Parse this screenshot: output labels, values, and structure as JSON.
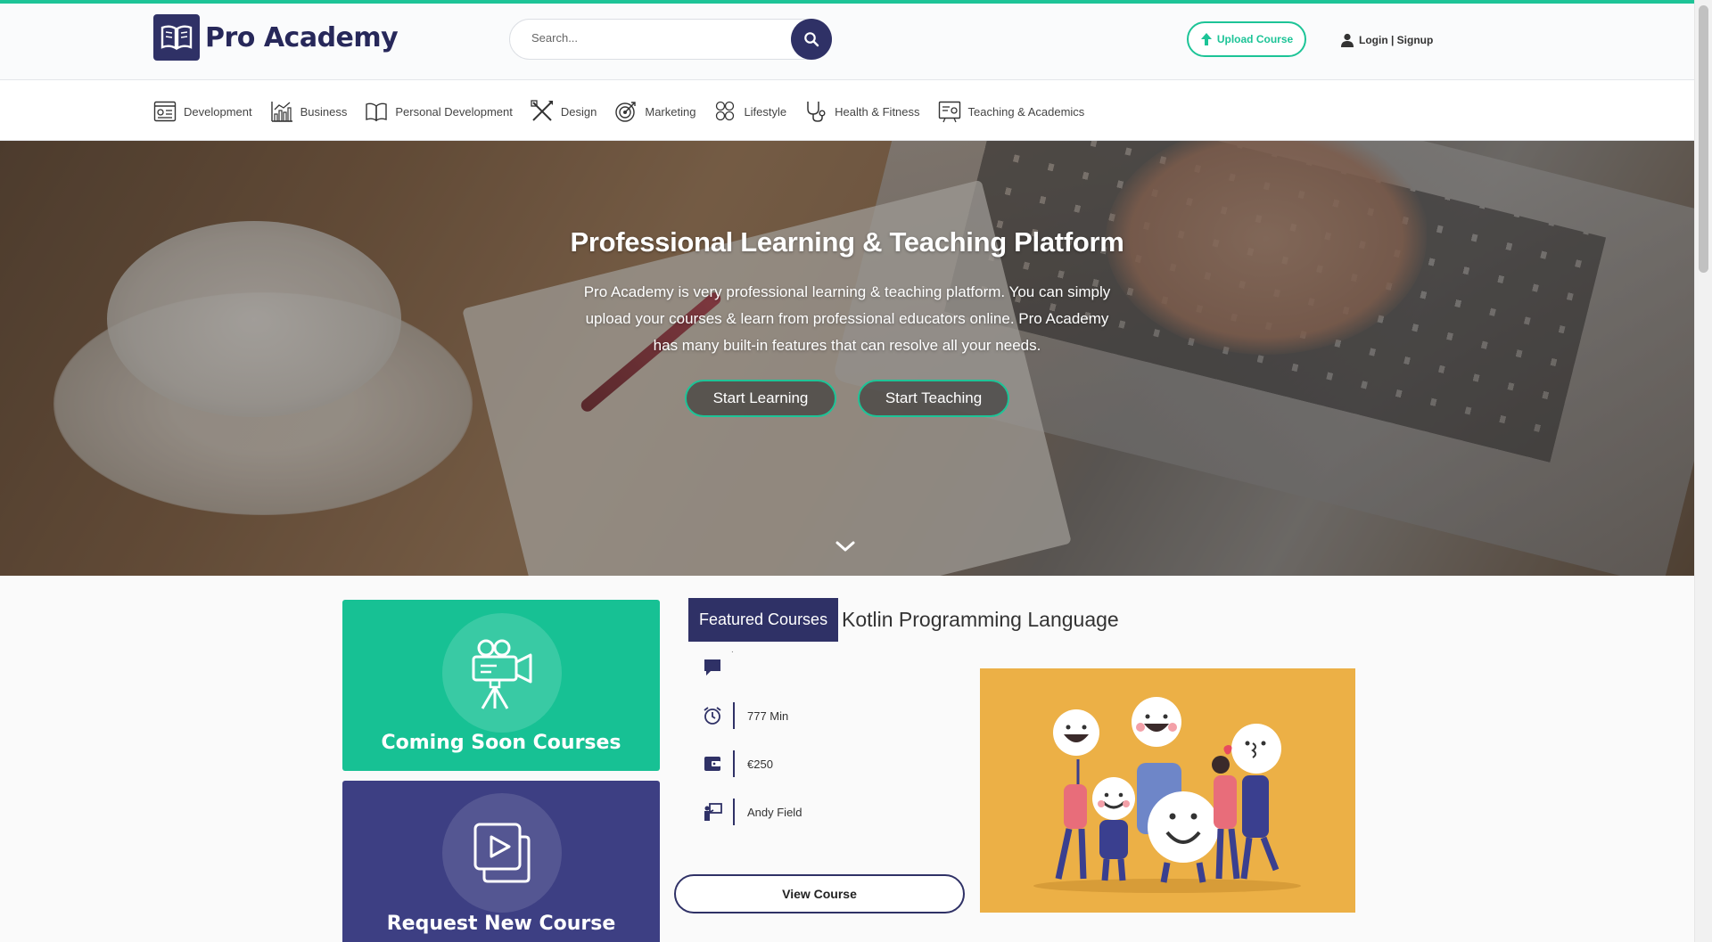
{
  "header": {
    "brand": "Pro Academy",
    "search_placeholder": "Search...",
    "upload_label": "Upload Course",
    "login_label": "Login | Signup"
  },
  "categories": [
    {
      "label": "Development",
      "icon": "development-icon"
    },
    {
      "label": "Business",
      "icon": "business-chart-icon"
    },
    {
      "label": "Personal Development",
      "icon": "open-book-icon"
    },
    {
      "label": "Design",
      "icon": "design-tools-icon"
    },
    {
      "label": "Marketing",
      "icon": "target-icon"
    },
    {
      "label": "Lifestyle",
      "icon": "lifestyle-icon"
    },
    {
      "label": "Health & Fitness",
      "icon": "stethoscope-icon"
    },
    {
      "label": "Teaching & Academics",
      "icon": "teaching-board-icon"
    }
  ],
  "hero": {
    "title": "Professional Learning & Teaching Platform",
    "description": "Pro Academy is very professional learning & teaching platform. You can simply upload your courses & learn from professional educators online. Pro Academy has many built-in features that can resolve all your needs.",
    "start_learning": "Start Learning",
    "start_teaching": "Start Teaching"
  },
  "promos": {
    "coming_soon": "Coming Soon Courses",
    "request_new": "Request New Course"
  },
  "featured": {
    "tag": "Featured Courses",
    "course_title": "Kotlin Programming Language",
    "comment_text": ".",
    "duration": "777 Min",
    "price": "€250",
    "instructor": "Andy Field",
    "view_button": "View Course"
  },
  "colors": {
    "brand": "#2f3166",
    "accent": "#1dc497",
    "course_image_bg": "#ecb046"
  }
}
